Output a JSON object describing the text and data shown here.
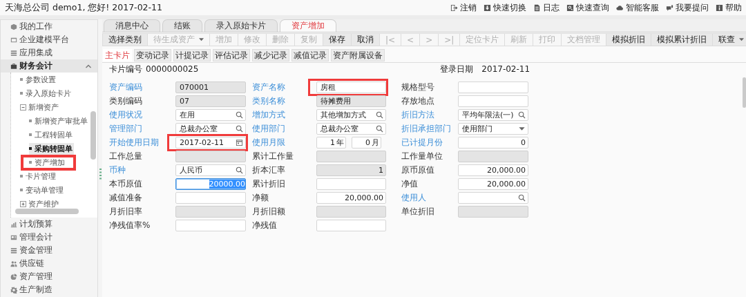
{
  "header": {
    "greeting": "天海总公司 demo1, 您好! 2017-02-11",
    "links": [
      "注销",
      "快速切换",
      "日志",
      "快速查询",
      "智能客服",
      "我要提问",
      "帮助"
    ]
  },
  "sidebar": {
    "items": [
      {
        "label": "我的工作",
        "expanded": false
      },
      {
        "label": "企业建模平台",
        "expanded": false
      },
      {
        "label": "应用集成",
        "expanded": false
      },
      {
        "label": "财务会计",
        "expanded": true,
        "children": [
          {
            "label": "参数设置",
            "kind": "leaf",
            "selected": false,
            "marked": false
          },
          {
            "label": "录入原始卡片",
            "kind": "leaf",
            "selected": false,
            "marked": false
          },
          {
            "label": "新增资产",
            "kind": "folder",
            "expanded": true,
            "selected": false,
            "marked": false,
            "children": [
              {
                "label": "新增资产审批单",
                "kind": "leaf",
                "selected": false,
                "marked": false
              },
              {
                "label": "工程转固单",
                "kind": "leaf",
                "selected": false,
                "marked": false
              },
              {
                "label": "采购转固单",
                "kind": "leaf",
                "selected": true,
                "marked": false
              },
              {
                "label": "资产增加",
                "kind": "leaf",
                "selected": false,
                "marked": true
              }
            ]
          },
          {
            "label": "卡片管理",
            "kind": "leaf",
            "selected": false,
            "marked": false
          },
          {
            "label": "变动单管理",
            "kind": "leaf",
            "selected": false,
            "marked": false
          },
          {
            "label": "资产维护",
            "kind": "folder",
            "expanded": false,
            "selected": false,
            "marked": false
          }
        ]
      },
      {
        "label": "计划预算",
        "expanded": false
      },
      {
        "label": "管理会计",
        "expanded": false
      },
      {
        "label": "资金管理",
        "expanded": false
      },
      {
        "label": "供应链",
        "expanded": false
      },
      {
        "label": "资产管理",
        "expanded": false
      },
      {
        "label": "生产制造",
        "expanded": false
      }
    ]
  },
  "tabs": [
    {
      "label": "消息中心",
      "selected": false
    },
    {
      "label": "结账",
      "selected": false
    },
    {
      "label": "录入原始卡片",
      "selected": false
    },
    {
      "label": "资产增加",
      "selected": true
    }
  ],
  "toolbar": [
    {
      "label": "选择类别",
      "kind": "button",
      "disabled": false
    },
    {
      "label": "待生成资产",
      "kind": "menu",
      "disabled": true
    },
    {
      "label": "增加",
      "kind": "button",
      "disabled": true
    },
    {
      "label": "修改",
      "kind": "button",
      "disabled": true
    },
    {
      "label": "删除",
      "kind": "button",
      "disabled": true
    },
    {
      "label": "复制",
      "kind": "button",
      "disabled": true
    },
    {
      "label": "保存",
      "kind": "button",
      "disabled": false
    },
    {
      "label": "取消",
      "kind": "button",
      "disabled": false
    },
    {
      "label": "|<",
      "kind": "button",
      "disabled": true
    },
    {
      "label": "<",
      "kind": "button",
      "disabled": true
    },
    {
      "label": ">",
      "kind": "button",
      "disabled": true
    },
    {
      "label": ">|",
      "kind": "button",
      "disabled": true
    },
    {
      "label": "定位卡片",
      "kind": "button",
      "disabled": true
    },
    {
      "label": "刷新",
      "kind": "button",
      "disabled": true
    },
    {
      "label": "打印",
      "kind": "button",
      "disabled": true
    },
    {
      "label": "文档管理",
      "kind": "button",
      "disabled": true
    },
    {
      "label": "模拟折旧",
      "kind": "button",
      "disabled": false
    },
    {
      "label": "模拟累计折旧",
      "kind": "button",
      "disabled": false
    },
    {
      "label": "联查",
      "kind": "menu",
      "disabled": false
    }
  ],
  "card_tabs": [
    {
      "label": "主卡片",
      "selected": true
    },
    {
      "label": "变动记录",
      "selected": false
    },
    {
      "label": "计提记录",
      "selected": false
    },
    {
      "label": "评估记录",
      "selected": false
    },
    {
      "label": "减少记录",
      "selected": false
    },
    {
      "label": "减值记录",
      "selected": false
    },
    {
      "label": "资产附属设备",
      "selected": false
    }
  ],
  "card": {
    "number_label": "卡片编号",
    "number": "0000000025",
    "date_label": "登录日期",
    "date": "2017-02-11"
  },
  "form": {
    "columns": [
      [
        {
          "label": "资产编码",
          "required": true,
          "kind": "text",
          "readonly": true,
          "focused": false,
          "marked": false,
          "value": "070001"
        },
        {
          "label": "类别编码",
          "required": false,
          "kind": "text",
          "readonly": true,
          "focused": false,
          "marked": false,
          "value": "07"
        },
        {
          "label": "使用状况",
          "required": true,
          "kind": "lookup",
          "readonly": false,
          "focused": false,
          "marked": false,
          "value": "在用"
        },
        {
          "label": "管理部门",
          "required": true,
          "kind": "lookup",
          "readonly": false,
          "focused": false,
          "marked": false,
          "value": "总裁办公室"
        },
        {
          "label": "开始使用日期",
          "required": true,
          "kind": "date",
          "readonly": false,
          "focused": false,
          "marked": true,
          "value": "2017-02-11"
        },
        {
          "label": "工作总量",
          "required": false,
          "kind": "number",
          "readonly": true,
          "focused": false,
          "marked": false
        },
        {
          "label": "币种",
          "required": true,
          "kind": "lookup",
          "readonly": false,
          "focused": false,
          "marked": false,
          "value": "人民币"
        },
        {
          "label": "本币原值",
          "required": false,
          "kind": "number",
          "readonly": false,
          "focused": true,
          "marked": false,
          "value": "20000.00"
        },
        {
          "label": "减值准备",
          "required": false,
          "kind": "number",
          "readonly": false,
          "focused": false,
          "marked": false
        },
        {
          "label": "月折旧率",
          "required": false,
          "kind": "number",
          "readonly": true,
          "focused": false,
          "marked": false
        },
        {
          "label": "净残值率%",
          "required": false,
          "kind": "number",
          "readonly": false,
          "focused": false,
          "marked": false
        }
      ],
      [
        {
          "label": "资产名称",
          "required": true,
          "kind": "text",
          "readonly": false,
          "focused": false,
          "marked": true,
          "value": "房租"
        },
        {
          "label": "类别名称",
          "required": true,
          "kind": "text",
          "readonly": true,
          "focused": false,
          "marked": false,
          "value": "待摊费用"
        },
        {
          "label": "增加方式",
          "required": true,
          "kind": "lookup",
          "readonly": false,
          "focused": false,
          "marked": false,
          "value": "其他增加方式"
        },
        {
          "label": "使用部门",
          "required": true,
          "kind": "lookup",
          "readonly": false,
          "focused": false,
          "marked": false,
          "value": "总裁办公室"
        },
        {
          "label": "使用月限",
          "required": true,
          "kind": "term",
          "readonly": false,
          "focused": false,
          "marked": false,
          "term": {
            "years": "1",
            "year_unit": "年",
            "months": "0",
            "month_unit": "月"
          }
        },
        {
          "label": "累计工作量",
          "required": false,
          "kind": "number",
          "readonly": true,
          "focused": false,
          "marked": false
        },
        {
          "label": "折本汇率",
          "required": false,
          "kind": "number",
          "readonly": true,
          "focused": false,
          "marked": false,
          "value": "1"
        },
        {
          "label": "累计折旧",
          "required": false,
          "kind": "number",
          "readonly": false,
          "focused": false,
          "marked": false
        },
        {
          "label": "净额",
          "required": false,
          "kind": "number",
          "readonly": false,
          "focused": false,
          "marked": false,
          "value": "20,000.00"
        },
        {
          "label": "月折旧额",
          "required": false,
          "kind": "number",
          "readonly": true,
          "focused": false,
          "marked": false
        },
        {
          "label": "净残值",
          "required": false,
          "kind": "number",
          "readonly": false,
          "focused": false,
          "marked": false
        }
      ],
      [
        {
          "label": "规格型号",
          "required": false,
          "kind": "text",
          "readonly": false,
          "focused": false,
          "marked": false
        },
        {
          "label": "存放地点",
          "required": false,
          "kind": "text",
          "readonly": false,
          "focused": false,
          "marked": false
        },
        {
          "label": "折旧方法",
          "required": true,
          "kind": "lookup",
          "readonly": false,
          "focused": false,
          "marked": false,
          "value": "平均年限法(一)"
        },
        {
          "label": "折旧承担部门",
          "required": true,
          "kind": "select",
          "readonly": false,
          "focused": false,
          "marked": false,
          "value": "使用部门"
        },
        {
          "label": "已计提月份",
          "required": true,
          "kind": "number",
          "readonly": false,
          "focused": false,
          "marked": false,
          "value": "0"
        },
        {
          "label": "工作量单位",
          "required": false,
          "kind": "text",
          "readonly": true,
          "focused": false,
          "marked": false
        },
        {
          "label": "原币原值",
          "required": false,
          "kind": "number",
          "readonly": false,
          "focused": false,
          "marked": false,
          "value": "20,000.00"
        },
        {
          "label": "净值",
          "required": false,
          "kind": "number",
          "readonly": false,
          "focused": false,
          "marked": false,
          "value": "20,000.00"
        },
        {
          "label": "使用人",
          "required": true,
          "kind": "lookup",
          "readonly": false,
          "focused": false,
          "marked": false
        },
        {
          "label": "单位折旧",
          "required": false,
          "kind": "number",
          "readonly": true,
          "focused": false,
          "marked": false
        }
      ]
    ]
  }
}
